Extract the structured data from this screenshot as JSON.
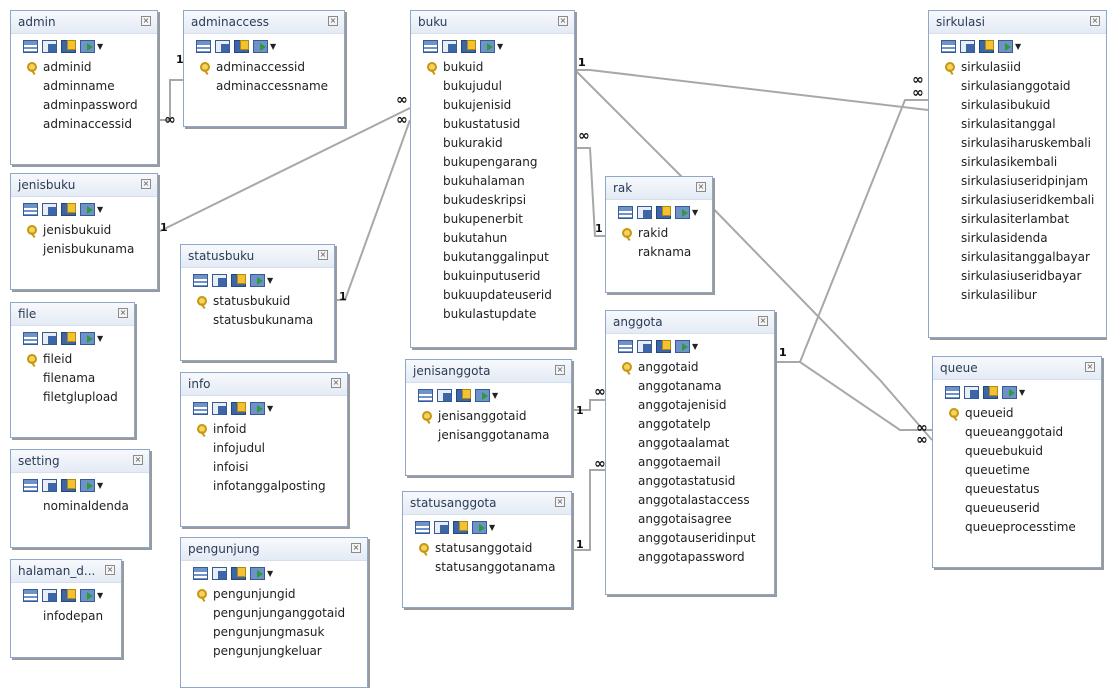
{
  "tables": [
    {
      "id": "admin",
      "title": "admin",
      "fields": [
        {
          "name": "adminid",
          "pk": true
        },
        {
          "name": "adminname"
        },
        {
          "name": "adminpassword"
        },
        {
          "name": "adminaccessid"
        }
      ]
    },
    {
      "id": "adminaccess",
      "title": "adminaccess",
      "fields": [
        {
          "name": "adminaccessid",
          "pk": true
        },
        {
          "name": "adminaccessname"
        }
      ]
    },
    {
      "id": "buku",
      "title": "buku",
      "fields": [
        {
          "name": "bukuid",
          "pk": true
        },
        {
          "name": "bukujudul"
        },
        {
          "name": "bukujenisid"
        },
        {
          "name": "bukustatusid"
        },
        {
          "name": "bukurakid"
        },
        {
          "name": "bukupengarang"
        },
        {
          "name": "bukuhalaman"
        },
        {
          "name": "bukudeskripsi"
        },
        {
          "name": "bukupenerbit"
        },
        {
          "name": "bukutahun"
        },
        {
          "name": "bukutanggalinput"
        },
        {
          "name": "bukuinputuserid"
        },
        {
          "name": "bukuupdateuserid"
        },
        {
          "name": "bukulastupdate"
        }
      ]
    },
    {
      "id": "sirkulasi",
      "title": "sirkulasi",
      "fields": [
        {
          "name": "sirkulasiid",
          "pk": true
        },
        {
          "name": "sirkulasianggotaid"
        },
        {
          "name": "sirkulasibukuid"
        },
        {
          "name": "sirkulasitanggal"
        },
        {
          "name": "sirkulasiharuskembali"
        },
        {
          "name": "sirkulasikembali"
        },
        {
          "name": "sirkulasiuseridpinjam"
        },
        {
          "name": "sirkulasiuseridkembali"
        },
        {
          "name": "sirkulasiterlambat"
        },
        {
          "name": "sirkulasidenda"
        },
        {
          "name": "sirkulasitanggalbayar"
        },
        {
          "name": "sirkulasiuseridbayar"
        },
        {
          "name": "sirkulasilibur"
        }
      ]
    },
    {
      "id": "jenisbuku",
      "title": "jenisbuku",
      "fields": [
        {
          "name": "jenisbukuid",
          "pk": true
        },
        {
          "name": "jenisbukunama"
        }
      ]
    },
    {
      "id": "statusbuku",
      "title": "statusbuku",
      "fields": [
        {
          "name": "statusbukuid",
          "pk": true
        },
        {
          "name": "statusbukunama"
        }
      ]
    },
    {
      "id": "rak",
      "title": "rak",
      "fields": [
        {
          "name": "rakid",
          "pk": true
        },
        {
          "name": "raknama"
        }
      ]
    },
    {
      "id": "file",
      "title": "file",
      "fields": [
        {
          "name": "fileid",
          "pk": true
        },
        {
          "name": "filenama"
        },
        {
          "name": "filetglupload"
        }
      ]
    },
    {
      "id": "info",
      "title": "info",
      "fields": [
        {
          "name": "infoid",
          "pk": true
        },
        {
          "name": "infojudul"
        },
        {
          "name": "infoisi"
        },
        {
          "name": "infotanggalposting"
        }
      ]
    },
    {
      "id": "anggota",
      "title": "anggota",
      "fields": [
        {
          "name": "anggotaid",
          "pk": true
        },
        {
          "name": "anggotanama"
        },
        {
          "name": "anggotajenisid"
        },
        {
          "name": "anggotatelp"
        },
        {
          "name": "anggotaalamat"
        },
        {
          "name": "anggotaemail"
        },
        {
          "name": "anggotastatusid"
        },
        {
          "name": "anggotalastaccess"
        },
        {
          "name": "anggotaisagree"
        },
        {
          "name": "anggotauseridinput"
        },
        {
          "name": "anggotapassword"
        }
      ]
    },
    {
      "id": "jenisanggota",
      "title": "jenisanggota",
      "fields": [
        {
          "name": "jenisanggotaid",
          "pk": true
        },
        {
          "name": "jenisanggotanama"
        }
      ]
    },
    {
      "id": "queue",
      "title": "queue",
      "fields": [
        {
          "name": "queueid",
          "pk": true
        },
        {
          "name": "queueanggotaid"
        },
        {
          "name": "queuebukuid"
        },
        {
          "name": "queuetime"
        },
        {
          "name": "queuestatus"
        },
        {
          "name": "queueuserid"
        },
        {
          "name": "queueprocesstime"
        }
      ]
    },
    {
      "id": "setting",
      "title": "setting",
      "fields": [
        {
          "name": "nominaldenda"
        }
      ]
    },
    {
      "id": "statusanggota",
      "title": "statusanggota",
      "fields": [
        {
          "name": "statusanggotaid",
          "pk": true
        },
        {
          "name": "statusanggotanama"
        }
      ]
    },
    {
      "id": "halaman_d",
      "title": "halaman_d...",
      "fields": [
        {
          "name": "infodepan"
        }
      ]
    },
    {
      "id": "pengunjung",
      "title": "pengunjung",
      "fields": [
        {
          "name": "pengunjungid",
          "pk": true
        },
        {
          "name": "pengunjunganggotaid"
        },
        {
          "name": "pengunjungmasuk"
        },
        {
          "name": "pengunjungkeluar"
        }
      ]
    }
  ],
  "relations": [
    {
      "id": "admin-adminaccess",
      "one": "1",
      "many": "∞"
    },
    {
      "id": "buku-jenisbuku",
      "one": "1",
      "many": "∞"
    },
    {
      "id": "buku-statusbuku",
      "one": "1",
      "many": "∞"
    },
    {
      "id": "buku-rak",
      "one": "1",
      "many": "∞"
    },
    {
      "id": "buku-sirkulasi",
      "one": "1",
      "many": "∞"
    },
    {
      "id": "buku-queue",
      "one": "1",
      "many": "∞"
    },
    {
      "id": "anggota-jenisanggota",
      "one": "1",
      "many": "∞"
    },
    {
      "id": "anggota-statusanggota",
      "one": "1",
      "many": "∞"
    },
    {
      "id": "anggota-sirkulasi",
      "one": "1",
      "many": "∞"
    },
    {
      "id": "anggota-queue",
      "one": "1",
      "many": "∞"
    }
  ]
}
